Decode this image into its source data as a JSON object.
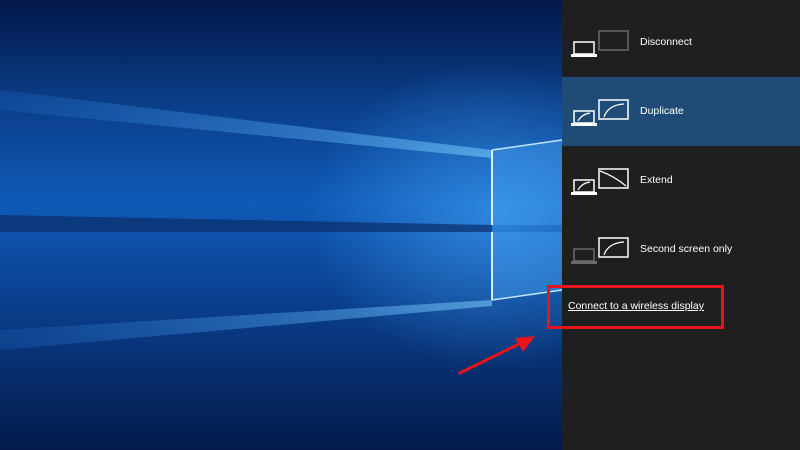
{
  "project_panel": {
    "options": [
      {
        "label": "Disconnect",
        "icon": "pc-screen-only-icon",
        "selected": false
      },
      {
        "label": "Duplicate",
        "icon": "duplicate-display-icon",
        "selected": true
      },
      {
        "label": "Extend",
        "icon": "extend-display-icon",
        "selected": false
      },
      {
        "label": "Second screen only",
        "icon": "second-screen-only-icon",
        "selected": false
      }
    ],
    "wireless_link": "Connect to a wireless display"
  },
  "colors": {
    "panel_bg": "#1f1f1f",
    "selected_bg": "#1e4c77",
    "highlight": "#e8141b"
  }
}
